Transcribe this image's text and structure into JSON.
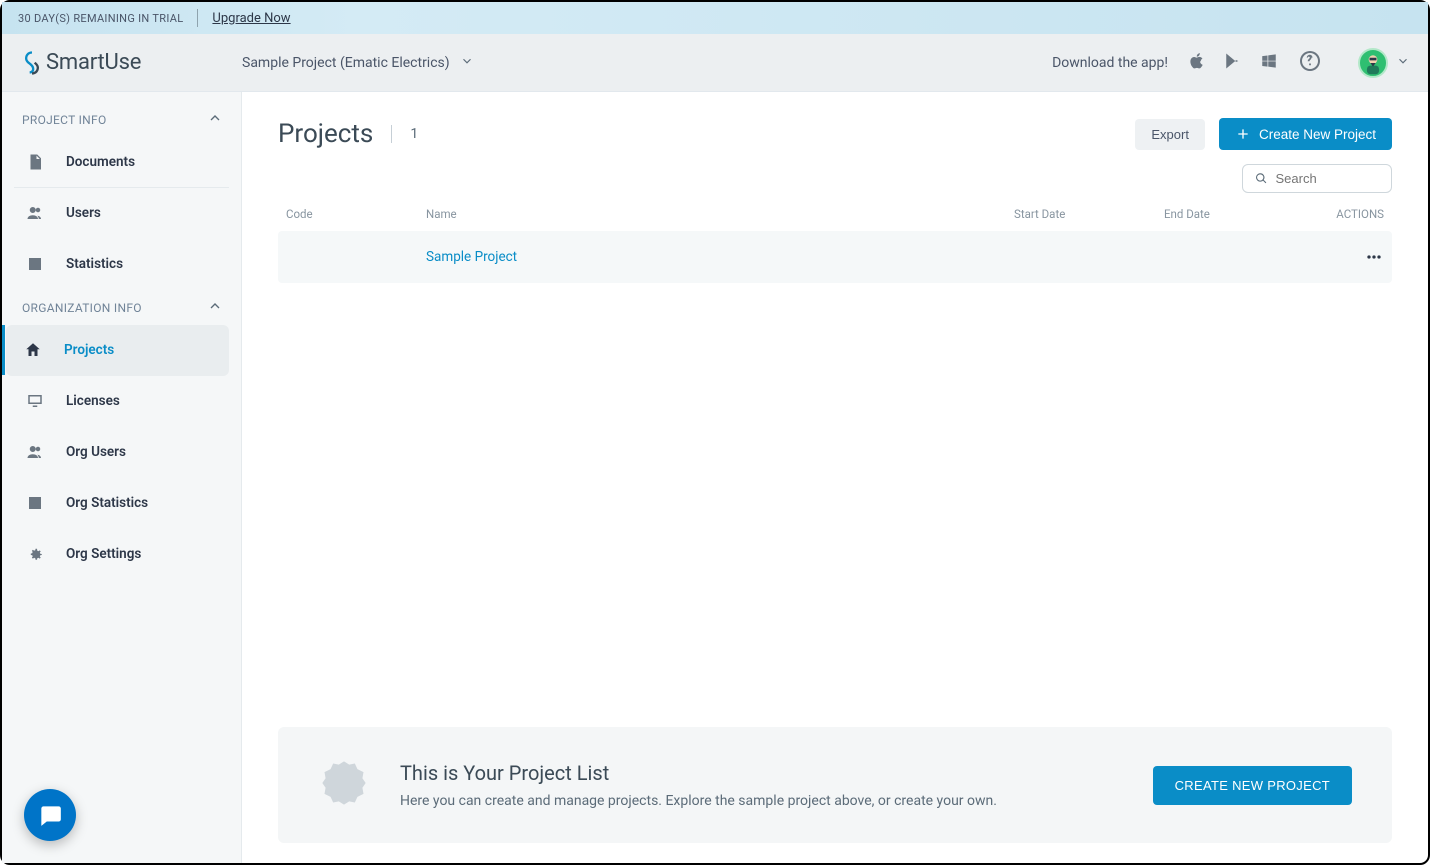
{
  "trial": {
    "remaining": "30 DAY(S) REMAINING IN TRIAL",
    "upgrade": "Upgrade Now"
  },
  "brand": "SmartUse",
  "project_selector": "Sample Project (Ematic Electrics)",
  "download_label": "Download the app!",
  "sidebar": {
    "section_project": "PROJECT INFO",
    "section_org": "ORGANIZATION INFO",
    "documents": "Documents",
    "users": "Users",
    "statistics": "Statistics",
    "projects": "Projects",
    "licenses": "Licenses",
    "org_users": "Org Users",
    "org_statistics": "Org Statistics",
    "org_settings": "Org Settings"
  },
  "page": {
    "title": "Projects",
    "count": "1",
    "export": "Export",
    "create": "Create New Project",
    "search_placeholder": "Search"
  },
  "table": {
    "headers": {
      "code": "Code",
      "name": "Name",
      "start": "Start Date",
      "end": "End Date",
      "actions": "ACTIONS"
    },
    "rows": [
      {
        "code": "",
        "name": "Sample Project",
        "start": "",
        "end": ""
      }
    ]
  },
  "info": {
    "title": "This is Your Project List",
    "body": "Here you can create and manage projects. Explore the sample project above, or create your own.",
    "cta": "CREATE NEW PROJECT"
  }
}
